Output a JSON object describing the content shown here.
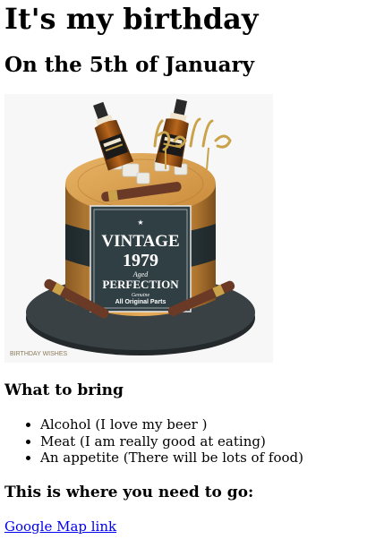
{
  "title": "It's my birthday",
  "subtitle": "On the 5th of January",
  "image": {
    "name": "birthday-cake",
    "cake_text": {
      "topper": "Hello",
      "line1": "VINTAGE",
      "year": "1979",
      "aged": "Aged",
      "perfection": "PERFECTION",
      "genuine": "Genuine",
      "parts": "All Original Parts",
      "watermark": "BIRTHDAY WISHES"
    },
    "colors": {
      "cake_wood": "#c98a3a",
      "cake_band": "#2e3b3d",
      "board": "#2f3436",
      "label_bg": "#2f3f44",
      "cigar": "#6b3a26",
      "gold": "#c9a24a",
      "bottle": "#8a4a14"
    }
  },
  "bring": {
    "heading": "What to bring",
    "items": [
      "Alcohol (I love my beer )",
      "Meat (I am really good at eating)",
      "An appetite (There will be lots of food)"
    ]
  },
  "location": {
    "heading": "This is where you need to go:",
    "link_text": "Google Map link"
  }
}
